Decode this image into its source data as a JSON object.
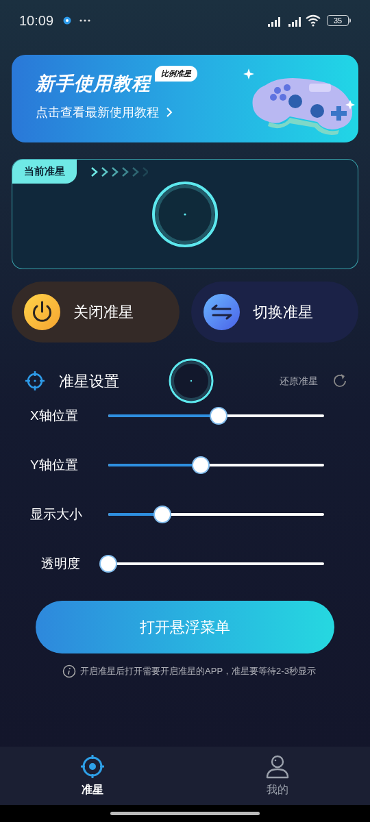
{
  "status_bar": {
    "time": "10:09",
    "battery": "35"
  },
  "banner": {
    "title": "新手使用教程",
    "badge": "比例准星",
    "subtitle": "点击查看最新使用教程"
  },
  "current_crosshair": {
    "label": "当前准星"
  },
  "actions": [
    {
      "kind": "power",
      "label": "关闭准星"
    },
    {
      "kind": "switch",
      "label": "切换准星"
    }
  ],
  "settings": {
    "title": "准星设置",
    "reset": "还原准星",
    "sliders": [
      {
        "label": "X轴位置",
        "level": 0.51
      },
      {
        "label": "Y轴位置",
        "level": 0.43
      },
      {
        "label": "显示大小",
        "level": 0.25
      },
      {
        "label": "透明度",
        "level": 0
      }
    ]
  },
  "float_button": "打开悬浮菜单",
  "note": "开启准星后打开需要开启准星的APP，准星要等待2-3秒显示",
  "nav": [
    {
      "kind": "crosshair",
      "label": "准星",
      "selected": true
    },
    {
      "kind": "user",
      "label": "我的",
      "selected": false
    }
  ]
}
